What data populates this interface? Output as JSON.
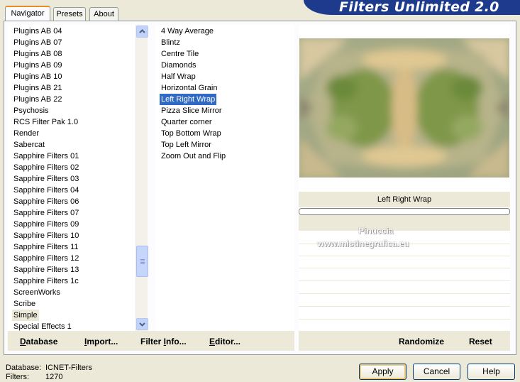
{
  "banner": {
    "title": "Filters Unlimited 2.0"
  },
  "tabs": [
    {
      "label": "Navigator",
      "active": true
    },
    {
      "label": "Presets",
      "active": false
    },
    {
      "label": "About",
      "active": false
    }
  ],
  "categories": {
    "items": [
      "Plugins AB 04",
      "Plugins AB 07",
      "Plugins AB 08",
      "Plugins AB 09",
      "Plugins AB 10",
      "Plugins AB 21",
      "Plugins AB 22",
      "Psychosis",
      "RCS Filter Pak 1.0",
      "Render",
      "Sabercat",
      "Sapphire Filters 01",
      "Sapphire Filters 02",
      "Sapphire Filters 03",
      "Sapphire Filters 04",
      "Sapphire Filters 06",
      "Sapphire Filters 07",
      "Sapphire Filters 09",
      "Sapphire Filters 10",
      "Sapphire Filters 11",
      "Sapphire Filters 12",
      "Sapphire Filters 13",
      "Sapphire Filters 1c",
      "ScreenWorks",
      "Scribe",
      "Simple",
      "Special Effects 1"
    ],
    "selected": "Simple"
  },
  "filters": {
    "items": [
      "4 Way Average",
      "Blintz",
      "Centre Tile",
      "Diamonds",
      "Half Wrap",
      "Horizontal Grain",
      "Left Right Wrap",
      "Pizza Slice Mirror",
      "Quarter corner",
      "Top Bottom Wrap",
      "Top Left Mirror",
      "Zoom Out and Flip"
    ],
    "selected": "Left Right Wrap"
  },
  "scrollbar": {
    "up_icon": "arrow-up-icon",
    "down_icon": "arrow-down-icon"
  },
  "bottom_left": {
    "database": {
      "prefix": "D",
      "rest": "atabase"
    },
    "import": {
      "prefix": "I",
      "rest": "mport..."
    },
    "filter_info": {
      "before": "Filter ",
      "accel": "I",
      "after": "nfo..."
    },
    "editor": {
      "accel": "E",
      "rest": "ditor..."
    }
  },
  "bottom_right": {
    "randomize": "Randomize",
    "reset": "Reset"
  },
  "preview": {
    "filter_name": "Left Right Wrap",
    "watermark_line1": "Pinuccia",
    "watermark_line2": "www.mistinegrafica.eu"
  },
  "status": {
    "database_label": "Database:",
    "database_value": "ICNET-Filters",
    "filters_label": "Filters:",
    "filters_value": "1270"
  },
  "buttons": {
    "apply": "Apply",
    "cancel": "Cancel",
    "help": "Help"
  },
  "colors": {
    "banner": "#1d3a8c",
    "selection": "#316ac5",
    "face": "#ece9d8"
  }
}
